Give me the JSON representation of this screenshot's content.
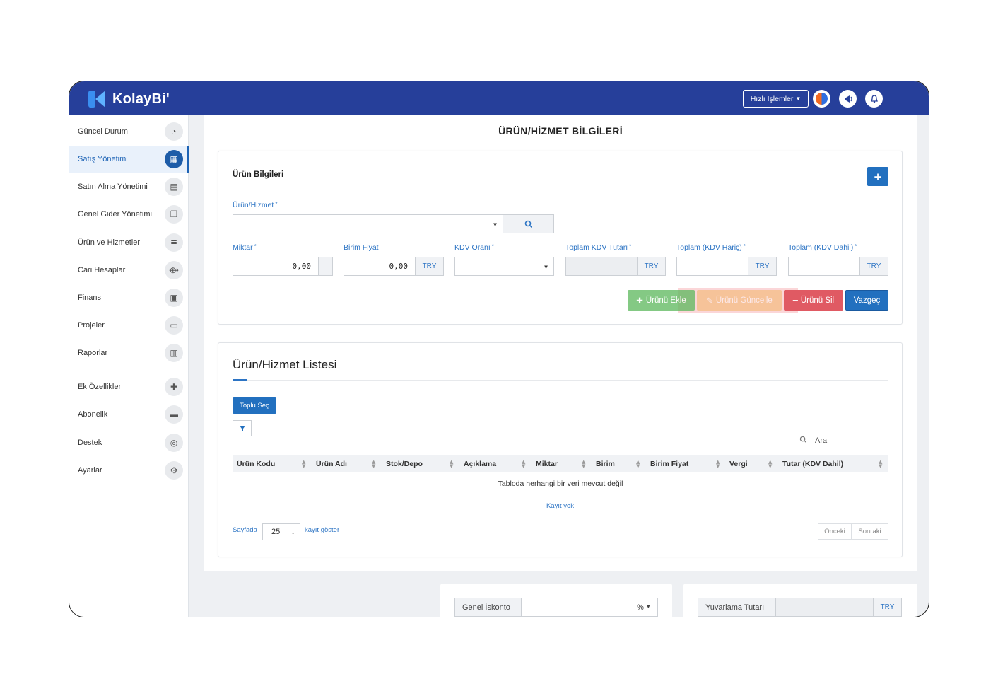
{
  "header": {
    "logo_text": "KolayBi'",
    "quick_actions_label": "Hızlı İşlemler",
    "icons": [
      "app-icon",
      "megaphone-icon",
      "bell-icon"
    ]
  },
  "sidebar": {
    "items": [
      {
        "label": "Güncel Durum",
        "icon": "dashboard-icon"
      },
      {
        "label": "Satış Yönetimi",
        "icon": "calculator-icon",
        "active": true
      },
      {
        "label": "Satın Alma Yönetimi",
        "icon": "document-icon"
      },
      {
        "label": "Genel Gider Yönetimi",
        "icon": "copy-icon"
      },
      {
        "label": "Ürün ve Hizmetler",
        "icon": "database-icon"
      },
      {
        "label": "Cari Hesaplar",
        "icon": "handshake-icon"
      },
      {
        "label": "Finans",
        "icon": "money-icon"
      },
      {
        "label": "Projeler",
        "icon": "folder-icon"
      },
      {
        "label": "Raporlar",
        "icon": "bar-chart-icon"
      },
      {
        "label": "Ek Özellikler",
        "icon": "puzzle-icon"
      },
      {
        "label": "Abonelik",
        "icon": "credit-card-icon"
      },
      {
        "label": "Destek",
        "icon": "lifebuoy-icon"
      },
      {
        "label": "Ayarlar",
        "icon": "gears-icon"
      }
    ]
  },
  "page": {
    "title": "ÜRÜN/HİZMET BİLGİLERİ"
  },
  "product_form": {
    "card_title": "Ürün Bilgileri",
    "add_button": "+",
    "product_label": "Ürün/Hizmet",
    "quantity_label": "Miktar",
    "quantity_value": "0,00",
    "unit_price_label": "Birim Fiyat",
    "unit_price_value": "0,00",
    "unit_price_currency": "TRY",
    "vat_rate_label": "KDV Oranı",
    "total_vat_label": "Toplam KDV Tutarı",
    "total_vat_currency": "TRY",
    "total_excl_label": "Toplam (KDV Hariç)",
    "total_excl_currency": "TRY",
    "total_incl_label": "Toplam (KDV Dahil)",
    "total_incl_currency": "TRY",
    "required_mark": "*",
    "buttons": {
      "add": "Ürünü Ekle",
      "update": "Ürünü Güncelle",
      "delete": "Ürünü Sil",
      "cancel": "Vazgeç"
    }
  },
  "product_list": {
    "title": "Ürün/Hizmet Listesi",
    "bulk_select": "Toplu Seç",
    "search_placeholder": "Ara",
    "columns": [
      "Ürün Kodu",
      "Ürün Adı",
      "Stok/Depo",
      "Açıklama",
      "Miktar",
      "Birim",
      "Birim Fiyat",
      "Vergi",
      "Tutar (KDV Dahil)"
    ],
    "empty_message": "Tabloda herhangi bir veri mevcut değil",
    "no_records": "Kayıt yok",
    "per_page_prefix": "Sayfada",
    "per_page_value": "25",
    "per_page_suffix": "kayıt göster",
    "prev": "Önceki",
    "next": "Sonraki"
  },
  "totals": {
    "discount_label": "Genel İskonto",
    "discount_unit": "%",
    "rounding_label": "Yuvarlama Tutarı",
    "rounding_currency": "TRY"
  }
}
